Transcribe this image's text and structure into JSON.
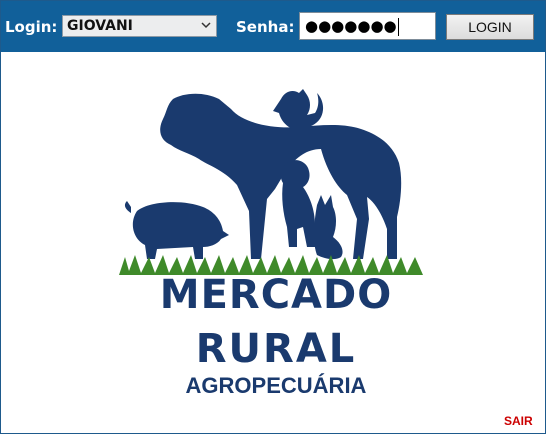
{
  "login": {
    "label": "Login:",
    "selected_user": "GIOVANI"
  },
  "senha": {
    "label": "Senha:",
    "value": "●●●●●●●"
  },
  "login_button": {
    "label": "LOGIN"
  },
  "logo": {
    "line1": "MERCADO",
    "line2": "RURAL",
    "line3": "AGROPECUÁRIA"
  },
  "footer": {
    "exit_label": "SAIR"
  },
  "colors": {
    "topbar": "#11609a",
    "logo_navy": "#1a3a6e",
    "grass": "#3f8a2a",
    "exit": "#cc0000"
  }
}
